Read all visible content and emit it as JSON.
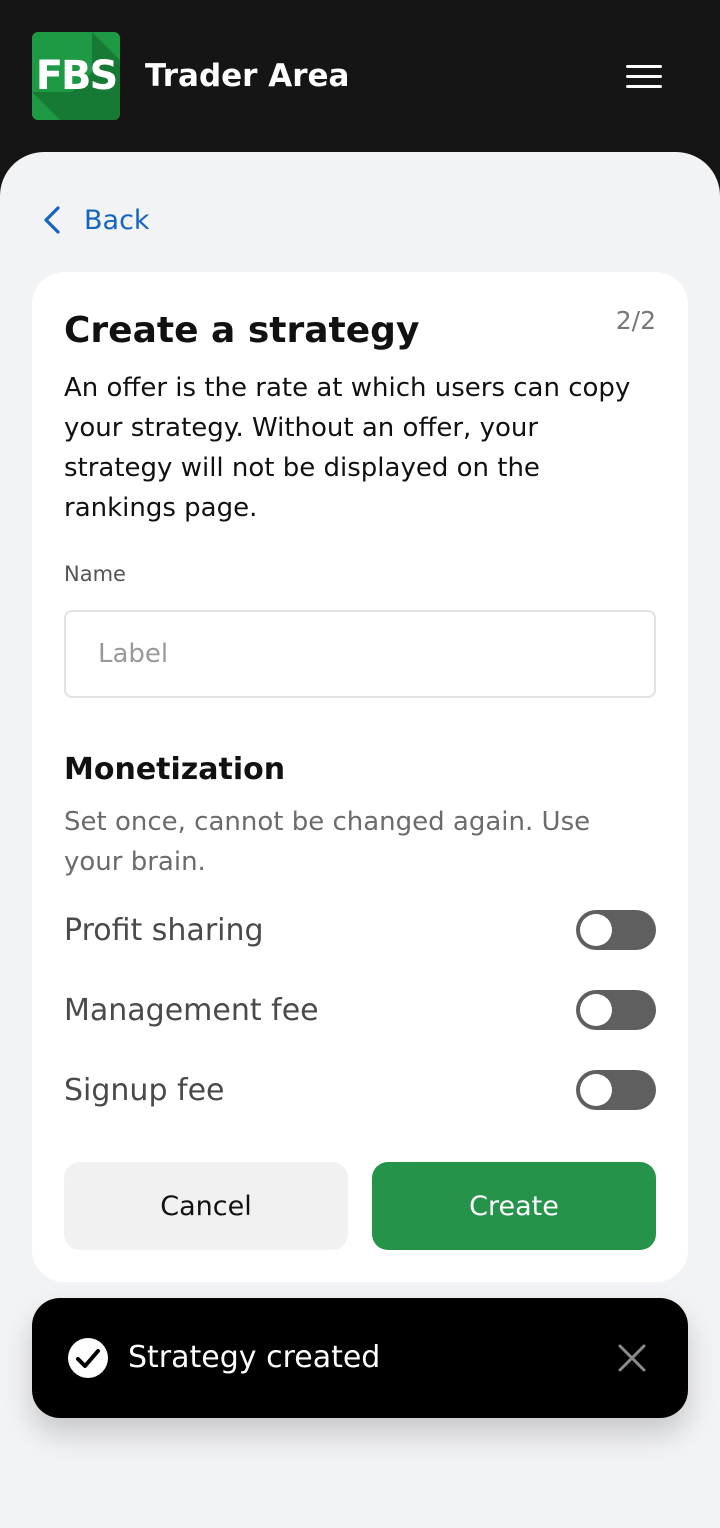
{
  "header": {
    "logo_text": "FBS",
    "title": "Trader Area",
    "menu_icon": "hamburger-menu-icon"
  },
  "nav": {
    "back_label": "Back",
    "back_icon": "chevron-left-icon"
  },
  "form": {
    "step": "2/2",
    "title": "Create a strategy",
    "description": "An offer is the rate at which users can copy your strategy. Without an offer, your strategy will not be displayed on the rankings page.",
    "name_label": "Name",
    "name_value": "",
    "name_placeholder": "Label",
    "monetization": {
      "title": "Monetization",
      "subtitle": "Set once, cannot be changed again. Use your brain.",
      "options": [
        {
          "label": "Profit sharing",
          "enabled": false
        },
        {
          "label": "Management fee",
          "enabled": false
        },
        {
          "label": "Signup fee",
          "enabled": false
        }
      ]
    },
    "cancel_label": "Cancel",
    "create_label": "Create"
  },
  "toast": {
    "message": "Strategy created",
    "icon": "check-circle-icon",
    "close_icon": "close-icon"
  },
  "colors": {
    "brand_green": "#25944a",
    "link_blue": "#1565c0",
    "header_bg": "#151515",
    "sheet_bg": "#f2f3f5"
  }
}
